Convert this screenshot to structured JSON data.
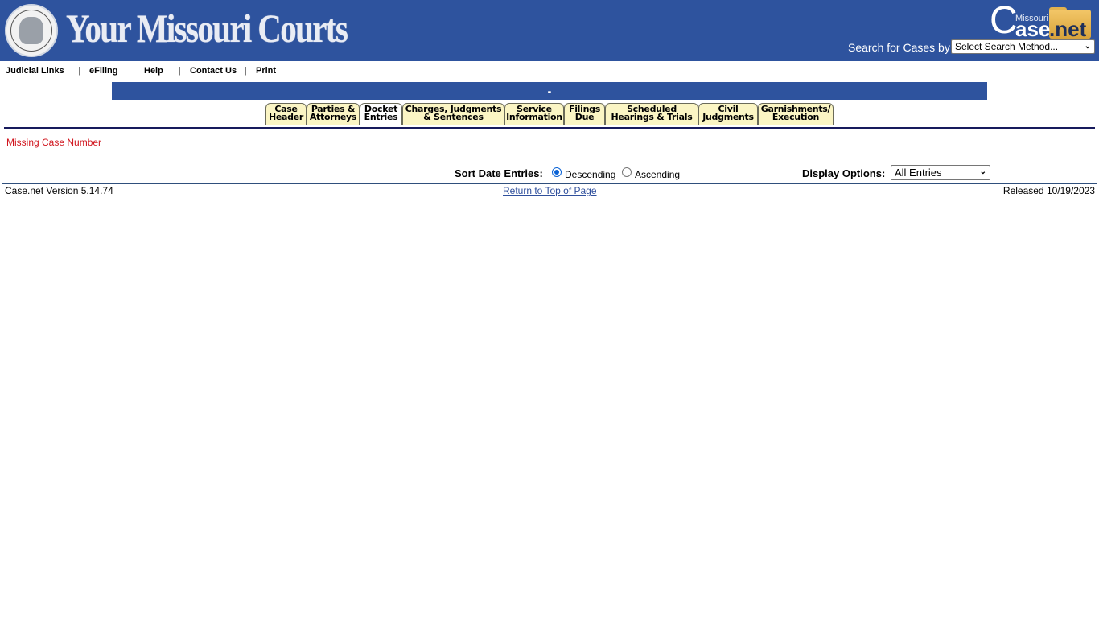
{
  "header": {
    "site_title": "Your Missouri Courts",
    "seal_icon": "missouri-supreme-court-seal",
    "logo": {
      "prefix": "C",
      "small": "Missouri",
      "middle": "ase",
      "suffix": ".net"
    },
    "search_label": "Search for Cases by:",
    "search_select_value": "Select Search Method...",
    "brand_color": "#2e539e"
  },
  "toplinks": [
    {
      "label": "Judicial Links"
    },
    {
      "label": "eFiling"
    },
    {
      "label": "Help"
    },
    {
      "label": "Contact Us"
    },
    {
      "label": "Print"
    }
  ],
  "separator": "|",
  "title_bar": {
    "text": "-"
  },
  "tabs": [
    {
      "line1": "Case",
      "line2": "Header",
      "active": false
    },
    {
      "line1": "Parties &",
      "line2": "Attorneys",
      "active": false
    },
    {
      "line1": "Docket",
      "line2": "Entries",
      "active": true
    },
    {
      "line1": "Charges, Judgments",
      "line2": "& Sentences",
      "active": false
    },
    {
      "line1": "Service",
      "line2": "Information",
      "active": false
    },
    {
      "line1": "Filings",
      "line2": "Due",
      "active": false
    },
    {
      "line1": "Scheduled",
      "line2": "Hearings & Trials",
      "active": false
    },
    {
      "line1": "Civil",
      "line2": "Judgments",
      "active": false
    },
    {
      "line1": "Garnishments/",
      "line2": "Execution",
      "active": false
    }
  ],
  "error": {
    "text": "Missing Case Number",
    "color": "#d0121b"
  },
  "sort": {
    "label": "Sort Date Entries:",
    "options": [
      {
        "label": "Descending",
        "checked": true
      },
      {
        "label": "Ascending",
        "checked": false
      }
    ]
  },
  "display": {
    "label": "Display Options:",
    "value": "All Entries"
  },
  "footer": {
    "version": "Case.net Version 5.14.74",
    "return_link": "Return to Top of Page",
    "released": "Released 10/19/2023"
  }
}
